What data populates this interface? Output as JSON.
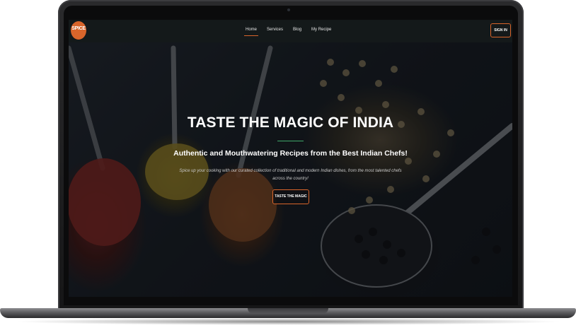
{
  "site": {
    "logo_text": "SPICE",
    "nav": {
      "links": [
        "Home",
        "Services",
        "Blog",
        "My Recipe"
      ],
      "active": "Home"
    },
    "signin_label": "SIGN IN"
  },
  "hero": {
    "title": "TASTE THE MAGIC OF INDIA",
    "subtitle": "Authentic and Mouthwatering Recipes from the Best Indian Chefs!",
    "description": "Spice up your cooking with our curated collection of traditional and modern Indian dishes, from the most talented chefs across the country!",
    "cta_label": "TASTE THE MAGIC"
  },
  "colors": {
    "accent": "#d9652b",
    "divider": "#3fa86a",
    "navbar": "#14191a"
  }
}
